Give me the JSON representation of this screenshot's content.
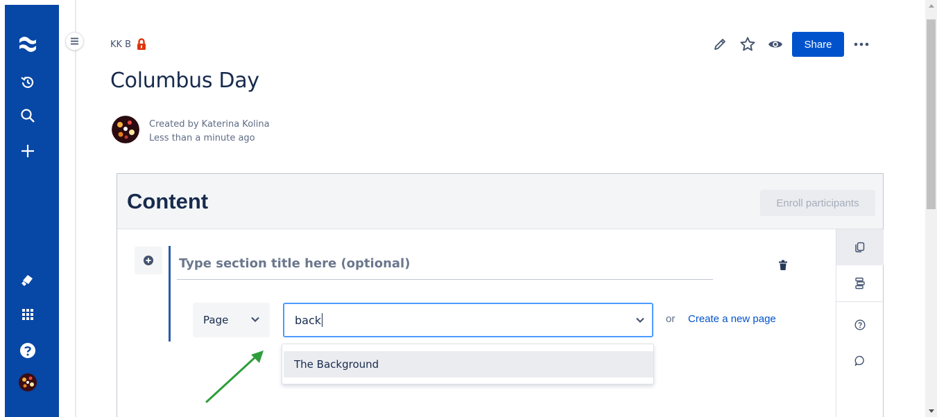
{
  "breadcrumb": {
    "space": "KK B",
    "restriction_icon": "lock-icon"
  },
  "page": {
    "title": "Columbus Day",
    "created_by": "Created by Katerina Kolina",
    "created_time": "Less than a minute ago"
  },
  "nav": {
    "icons": [
      "confluence-logo-icon",
      "history-icon",
      "search-icon",
      "plus-icon",
      "notification-icon",
      "app-switcher-icon",
      "help-icon",
      "profile-avatar"
    ]
  },
  "header_actions": {
    "share_label": "Share",
    "icons": [
      "edit-icon",
      "star-icon",
      "watch-icon",
      "more-icon"
    ]
  },
  "macro": {
    "title": "Content",
    "enroll_label": "Enroll participants",
    "section_placeholder": "Type section title here (optional)",
    "type_select_value": "Page",
    "search_value": "back",
    "or_text": "or",
    "create_link": "Create a new page",
    "suggestions": [
      "The Background"
    ]
  },
  "colors": {
    "nav_blue": "#0747a6",
    "share_blue": "#0052cc",
    "focus_border": "#4c9aff",
    "annotation_arrow": "#2e9e3a",
    "restriction_red": "#de350b"
  }
}
